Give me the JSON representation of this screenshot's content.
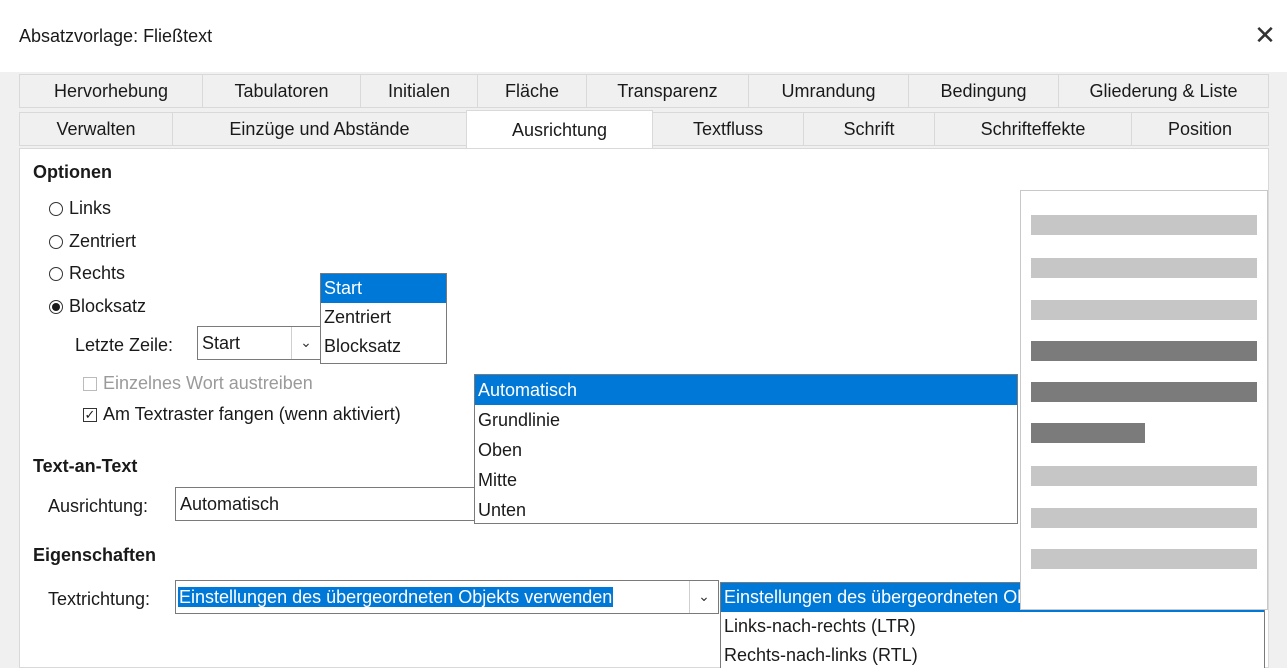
{
  "window": {
    "title": "Absatzvorlage: Fließtext",
    "close_glyph": "✕"
  },
  "tabs_row1": [
    "Hervorhebung",
    "Tabulatoren",
    "Initialen",
    "Fläche",
    "Transparenz",
    "Umrandung",
    "Bedingung",
    "Gliederung & Liste"
  ],
  "tabs_row2": [
    "Verwalten",
    "Einzüge und Abstände",
    "Ausrichtung",
    "Textfluss",
    "Schrift",
    "Schrifteffekte",
    "Position"
  ],
  "active_tab": "Ausrichtung",
  "options": {
    "heading": "Optionen",
    "radios": [
      {
        "label": "Links",
        "selected": false
      },
      {
        "label": "Zentriert",
        "selected": false
      },
      {
        "label": "Rechts",
        "selected": false
      },
      {
        "label": "Blocksatz",
        "selected": true
      }
    ],
    "last_line_label": "Letzte Zeile:",
    "last_line_value": "Start",
    "last_line_options": [
      "Start",
      "Zentriert",
      "Blocksatz"
    ],
    "single_word_label": "Einzelnes Wort austreiben",
    "single_word_checked": false,
    "snap_label": "Am Textraster fangen (wenn aktiviert)",
    "snap_checked": true
  },
  "text_to_text": {
    "heading": "Text-an-Text",
    "alignment_label": "Ausrichtung:",
    "alignment_value": "Automatisch",
    "alignment_options": [
      "Automatisch",
      "Grundlinie",
      "Oben",
      "Mitte",
      "Unten"
    ]
  },
  "properties": {
    "heading": "Eigenschaften",
    "direction_label": "Textrichtung:",
    "direction_value": "Einstellungen des übergeordneten Objekts verwenden",
    "direction_options": [
      "Einstellungen des übergeordneten Objekts verwenden",
      "Links-nach-rechts (LTR)",
      "Rechts-nach-links (RTL)"
    ]
  },
  "colors": {
    "accent": "#0078d7",
    "preview_light": "#c6c6c6",
    "preview_dark": "#7b7b7b"
  }
}
